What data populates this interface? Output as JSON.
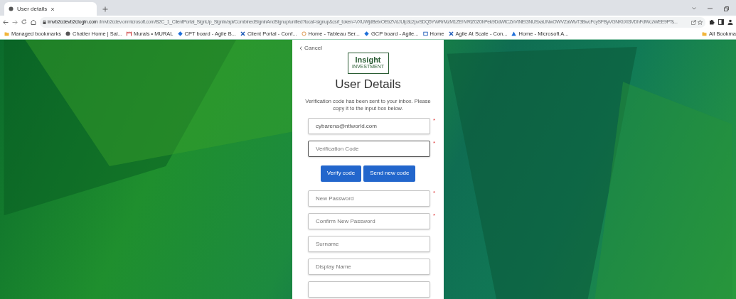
{
  "browser": {
    "tabs": [
      {
        "title": "User details",
        "selected": true
      }
    ],
    "address": {
      "host": "imvb2cdevb2clogin.com",
      "path": "/imvb2cdev.onmicrosoft.com/B2C_1_ClientPortal_SignUp_SignIn/api/CombinedSigninAndSignup/unified?local=signup&csrf_token=VXUWjdBetvOEtrZVdJUlp3c2pvSDQ5YWRrMzM1ZEhVRlZ0Z0hPek9DdWtCZnVtNEI3NUSxaUNwOWVZaWtvT3BwcFcySFByVGNKbXI3VDhFdWczWEE9PTs..."
    },
    "bookmarks": [
      {
        "label": "Managed bookmarks",
        "kind": "folder"
      },
      {
        "label": "Chatter Home | Sal...",
        "kind": "globe"
      },
      {
        "label": "Murals • MURAL",
        "kind": "mural"
      },
      {
        "label": "CPT board - Agile B...",
        "kind": "diamond"
      },
      {
        "label": "Client Portal - Conf...",
        "kind": "cross"
      },
      {
        "label": "Home - Tableau Ser...",
        "kind": "ring"
      },
      {
        "label": "GCP board - Agile...",
        "kind": "diamond"
      },
      {
        "label": "Home",
        "kind": "square"
      },
      {
        "label": "Agile At Scale - Con...",
        "kind": "cross"
      },
      {
        "label": "Home - Microsoft A...",
        "kind": "triangle"
      }
    ],
    "all_bookmarks": {
      "label": "All Bookma",
      "kind": "folder"
    }
  },
  "form": {
    "cancel": "Cancel",
    "logo": {
      "line1": "Insight",
      "line2": "INVESTMENT"
    },
    "title": "User Details",
    "message": "Verification code has been sent to your inbox. Please copy it to the input box below.",
    "fields": [
      {
        "value": "cybarena@ntlworld.com",
        "required_mark": "*",
        "focused": false
      },
      {
        "placeholder": "Verification Code",
        "required_mark": "*",
        "focused": true
      }
    ],
    "buttons": [
      "Verify code",
      "Send new code"
    ],
    "more_fields": [
      {
        "placeholder": "New Password",
        "required_mark": "*",
        "focused": false
      },
      {
        "placeholder": "Confirm New Password",
        "required_mark": "*",
        "focused": false
      },
      {
        "placeholder": "Surname",
        "focused": false
      },
      {
        "placeholder": "Display Name",
        "focused": false
      },
      {
        "focused": false
      }
    ]
  }
}
